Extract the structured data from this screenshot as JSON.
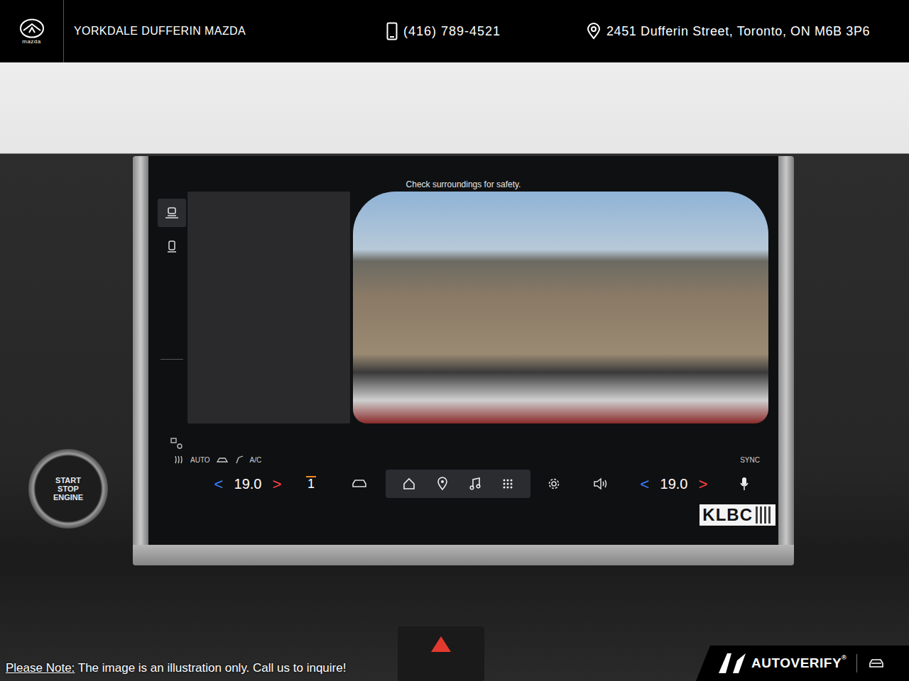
{
  "dealer": {
    "logo_caption": "mazda",
    "name": "YORKDALE DUFFERIN MAZDA",
    "phone": "(416) 789-4521",
    "address": "2451 Dufferin Street, Toronto, ON M6B 3P6"
  },
  "screen": {
    "notice": "Check surroundings for safety.",
    "view_buttons": [
      {
        "selected": true
      },
      {
        "selected": false
      }
    ]
  },
  "climate": {
    "auto": "AUTO",
    "ac": "A/C",
    "sync": "SYNC",
    "left_dec": "<",
    "left_temp": "19.0",
    "left_inc": ">",
    "fan": "1",
    "right_dec": "<",
    "right_temp": "19.0",
    "right_inc": ">"
  },
  "sticker": "KLBC",
  "start_button": [
    "START",
    "STOP",
    "ENGINE"
  ],
  "footer": {
    "note_label": "Please Note:",
    "note": "The image is an illustration only. Call us to inquire!",
    "brand": "AUTOVERIFY",
    "registered": "®"
  }
}
